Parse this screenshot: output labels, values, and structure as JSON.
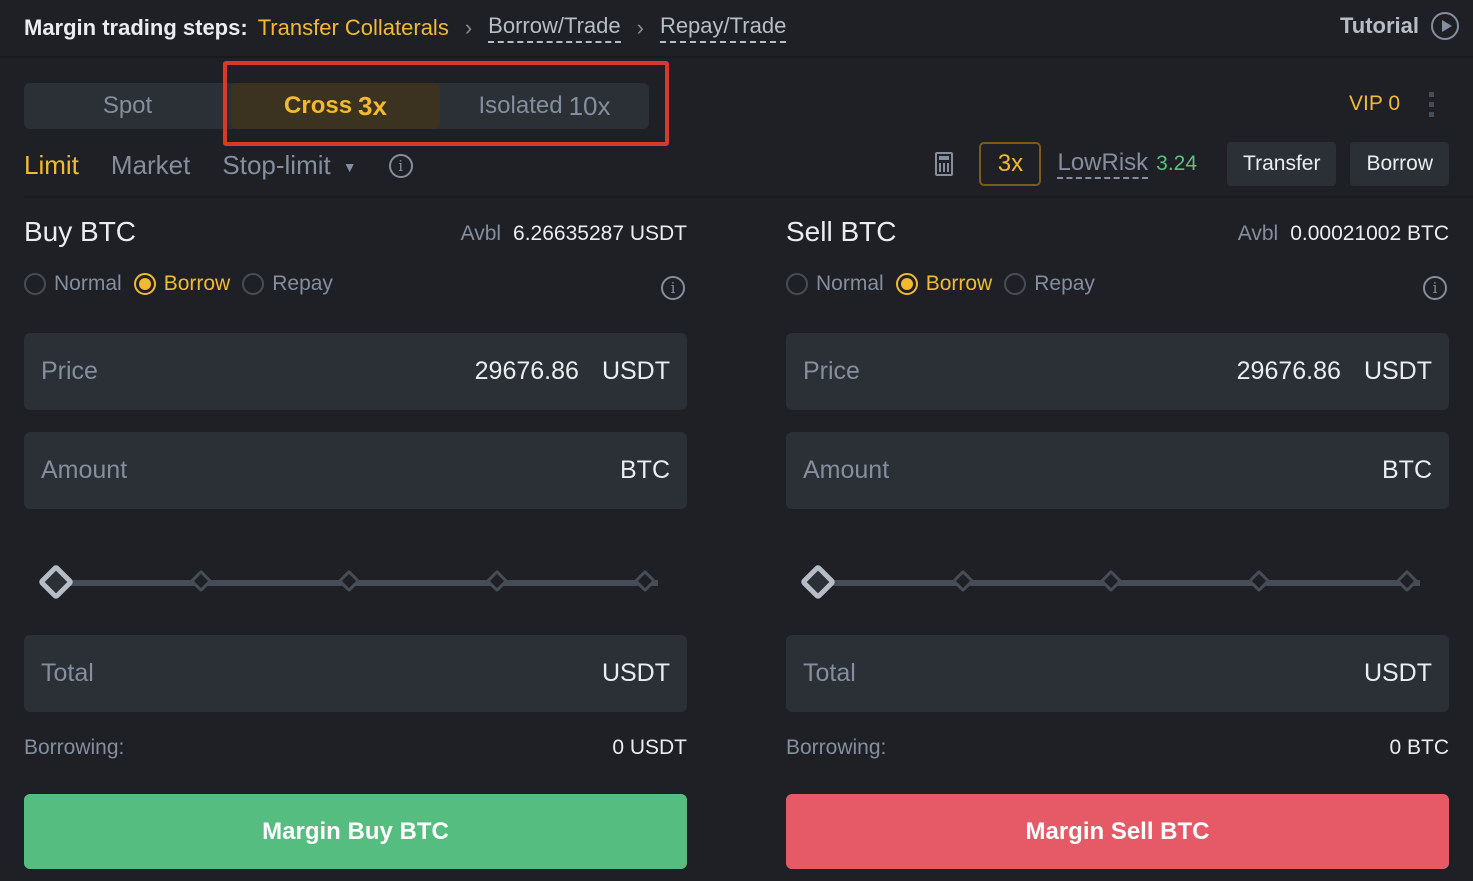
{
  "topbar": {
    "steps_label": "Margin trading steps:",
    "steps": [
      {
        "label": "Transfer Collaterals",
        "state": "active"
      },
      {
        "label": "Borrow/Trade",
        "state": "link"
      },
      {
        "label": "Repay/Trade",
        "state": "link"
      }
    ],
    "tutorial_label": "Tutorial",
    "tutorial_icon": "play-circle-icon"
  },
  "mode_tabs": [
    {
      "label": "Spot",
      "leverage": "",
      "selected": false
    },
    {
      "label": "Cross",
      "leverage": "3x",
      "selected": true
    },
    {
      "label": "Isolated",
      "leverage": "10x",
      "selected": false
    }
  ],
  "vip_label": "VIP 0",
  "order_tabs": [
    {
      "label": "Limit",
      "active": true
    },
    {
      "label": "Market",
      "active": false
    },
    {
      "label": "Stop-limit",
      "active": false,
      "dropdown": true
    }
  ],
  "tools": {
    "calculator_icon": "calculator-icon",
    "leverage": "3x",
    "risk_label": "LowRisk",
    "risk_value": "3.24",
    "transfer_label": "Transfer",
    "borrow_label": "Borrow"
  },
  "colors": {
    "accent": "#f3ba2f",
    "buy": "#55bd7f",
    "sell": "#e55a66",
    "risk_ok": "#5bc27e",
    "highlight": "#d63a2a"
  },
  "buy": {
    "title": "Buy BTC",
    "avbl_label": "Avbl",
    "avbl_value": "6.26635287 USDT",
    "modes": [
      {
        "label": "Normal",
        "selected": false
      },
      {
        "label": "Borrow",
        "selected": true
      },
      {
        "label": "Repay",
        "selected": false
      }
    ],
    "price_label": "Price",
    "price_value": "29676.86",
    "price_unit": "USDT",
    "amount_label": "Amount",
    "amount_value": "",
    "amount_unit": "BTC",
    "slider_percent": 0,
    "total_label": "Total",
    "total_value": "",
    "total_unit": "USDT",
    "borrowing_label": "Borrowing:",
    "borrowing_value": "0 USDT",
    "action_label": "Margin Buy BTC"
  },
  "sell": {
    "title": "Sell BTC",
    "avbl_label": "Avbl",
    "avbl_value": "0.00021002 BTC",
    "modes": [
      {
        "label": "Normal",
        "selected": false
      },
      {
        "label": "Borrow",
        "selected": true
      },
      {
        "label": "Repay",
        "selected": false
      }
    ],
    "price_label": "Price",
    "price_value": "29676.86",
    "price_unit": "USDT",
    "amount_label": "Amount",
    "amount_value": "",
    "amount_unit": "BTC",
    "slider_percent": 0,
    "total_label": "Total",
    "total_value": "",
    "total_unit": "USDT",
    "borrowing_label": "Borrowing:",
    "borrowing_value": "0 BTC",
    "action_label": "Margin Sell BTC"
  }
}
